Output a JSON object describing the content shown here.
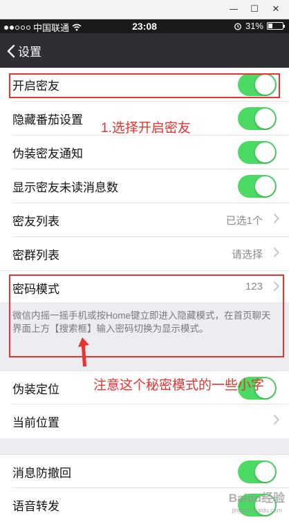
{
  "window": {
    "minimize": "—",
    "maximize": "☐",
    "close": "✕"
  },
  "status": {
    "carrier": "中国联通",
    "time": "23:08",
    "battery": "31%",
    "battery_level": 0.31
  },
  "nav": {
    "back_label": "设置"
  },
  "settings": {
    "enable_friend": "开启密友",
    "hide_tomato": "隐藏番茄设置",
    "fake_notify": "伪装密友通知",
    "show_unread": "显示密友未读消息数",
    "friend_list": "密友列表",
    "friend_list_value": "已选1个",
    "group_list": "密群列表",
    "group_list_value": "请选择",
    "password_mode": "密码模式",
    "password_mode_value": "123",
    "password_note": "微信内摇一摇手机或按Home键立即进入隐藏模式，在首页聊天界面上方【搜索框】输入密码切换为显示模式。",
    "fake_location": "伪装定位",
    "current_location": "当前位置",
    "anti_recall": "消息防撤回",
    "voice_forward": "语音转发"
  },
  "annotations": {
    "step1": "1.选择开启密友",
    "note2": "注意这个秘密模式的一些小字"
  },
  "watermark": {
    "brand": "Baidu经验",
    "url": "jingyan.baidu.com"
  },
  "colors": {
    "toggle_on": "#4cd964",
    "annotation": "#e8322d",
    "nav_bg": "#2f2f33"
  }
}
